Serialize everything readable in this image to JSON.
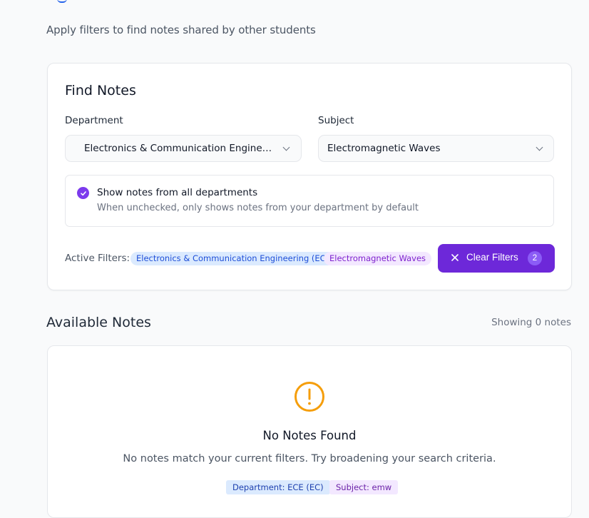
{
  "page": {
    "subtitle": "Apply filters to find notes shared by other students"
  },
  "filters": {
    "title": "Find Notes",
    "department": {
      "label": "Department",
      "value": "Electronics & Communication Engineerin…"
    },
    "subject": {
      "label": "Subject",
      "value": "Electromagnetic Waves"
    },
    "all_departments": {
      "checked": true,
      "label": "Show notes from all departments",
      "description": "When unchecked, only shows notes from your department by default"
    },
    "active": {
      "label": "Active Filters:",
      "chips": [
        "Electronics & Communication Engineering (EC)",
        "Electromagnetic Waves"
      ]
    },
    "clear_button": {
      "label": "Clear Filters",
      "count": "2"
    }
  },
  "notes": {
    "title": "Available Notes",
    "showing": "Showing 0 notes",
    "empty": {
      "title": "No Notes Found",
      "description": "No notes match your current filters. Try broadening your search criteria.",
      "tags": [
        "Department: ECE (EC)",
        "Subject: emw"
      ]
    }
  },
  "colors": {
    "primary": "#6d28d9",
    "warning_icon": "#f59e0b",
    "chip_blue_bg": "#dbeafe",
    "chip_purple_bg": "#f3e8ff"
  },
  "icons": {
    "select_chevron": "chevron-down-icon",
    "checkbox": "check-icon",
    "clear": "close-icon",
    "empty": "alert-circle-icon"
  }
}
